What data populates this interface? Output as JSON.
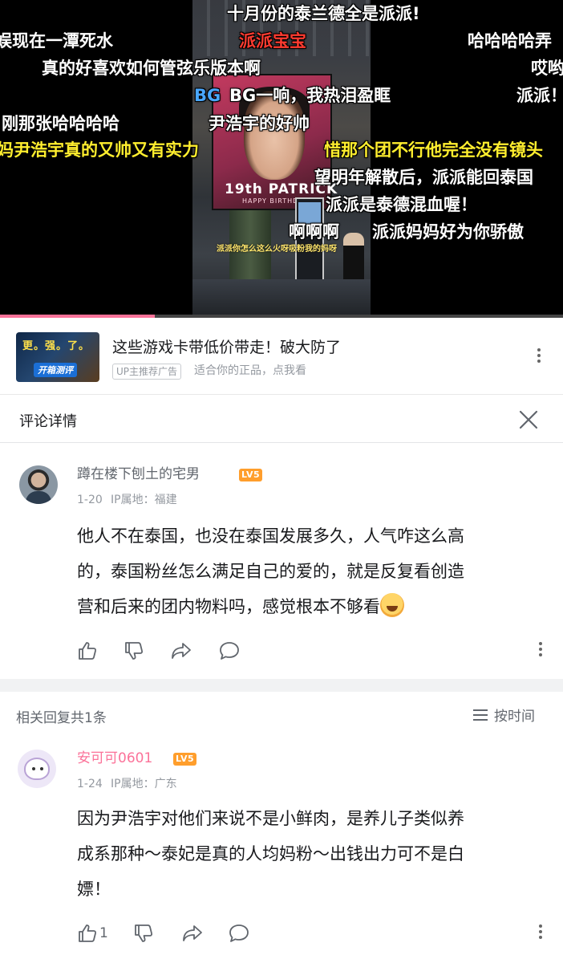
{
  "video": {
    "danmaku": [
      {
        "text": "十月份的泰兰德全是派派!",
        "color": "white"
      },
      {
        "text": "娱现在一潭死水",
        "color": "white"
      },
      {
        "text": "派派宝宝",
        "color": "red"
      },
      {
        "text": "哈哈哈哈弄",
        "color": "white"
      },
      {
        "text": "真的好喜欢如何管弦乐版本啊",
        "color": "white"
      },
      {
        "text": "哎哟",
        "color": "white"
      },
      {
        "text": "BG",
        "color": "blue"
      },
      {
        "text": "BG一响，我热泪盈眶",
        "color": "white"
      },
      {
        "text": "派派！",
        "color": "white"
      },
      {
        "text": "刚那张哈哈哈哈",
        "color": "white"
      },
      {
        "text": "尹浩宇的好帅",
        "color": "white"
      },
      {
        "text": "妈尹浩宇真的又帅又有实力",
        "color": "yellow"
      },
      {
        "text": "惜那个团不行他完全没有镜头",
        "color": "yellow"
      },
      {
        "text": "望明年解散后，派派能回泰国",
        "color": "white"
      },
      {
        "text": "派派是泰德混血喔！",
        "color": "white"
      },
      {
        "text": "啊啊啊",
        "color": "white"
      },
      {
        "text": "派派妈妈好为你骄傲",
        "color": "white"
      }
    ],
    "billboard_name": "19th PATRICK",
    "billboard_sub": "HAPPY BIRTHDAY",
    "caption": "派派你怎么这么火呀吸粉我的妈呀",
    "progress": 0.275
  },
  "ad": {
    "thumb_top": "更。强。了。",
    "thumb_badge": "开箱测评",
    "title": "这些游戏卡带低价带走！破大防了",
    "tag": "UP主推荐广告",
    "subtitle": "适合你的正品，点我看"
  },
  "comment_detail": {
    "title": "评论详情"
  },
  "main_comment": {
    "username": "蹲在楼下刨土的宅男",
    "level": "LV5",
    "date": "1-20",
    "ip": "IP属地：福建",
    "lines": [
      "他人不在泰国，也没在泰国发展多久，人气咋这么高",
      "的，泰国粉丝怎么满足自己的爱的，就是反复看创造",
      "营和后来的团内物料吗，感觉根本不够看"
    ]
  },
  "replies_header": {
    "count_label": "相关回复共1条",
    "sort_label": "按时间"
  },
  "reply": {
    "username": "安可可0601",
    "level": "LV5",
    "date": "1-24",
    "ip": "IP属地：广东",
    "lines": [
      "因为尹浩宇对他们来说不是小鲜肉，是养儿子类似养",
      "成系那种～泰妃是真的人均妈粉～出钱出力可不是白",
      "嫖！"
    ],
    "like_count": "1"
  },
  "colors": {
    "accent_pink": "#fb7299",
    "level_orange": "#ff9e2c",
    "danmaku_yellow": "#ffee2e",
    "danmaku_red": "#ff3b30",
    "danmaku_blue": "#49a7ff"
  },
  "icons": [
    "close-icon",
    "more-icon",
    "like-icon",
    "dislike-icon",
    "share-icon",
    "comment-icon",
    "sort-icon"
  ]
}
